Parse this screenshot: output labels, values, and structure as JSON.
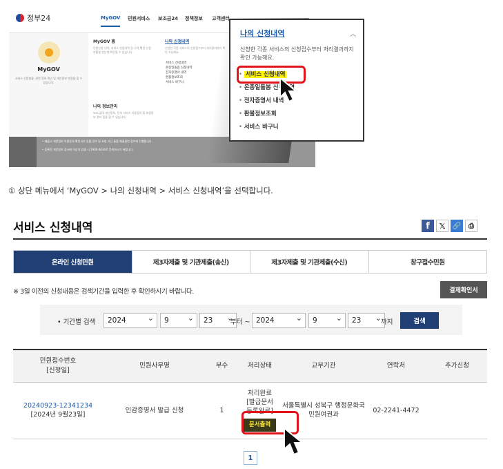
{
  "tutorial": {
    "logo": "정부24",
    "gnb": [
      "MyGOV",
      "민원서비스",
      "보조금24",
      "정책정보",
      "고객센터"
    ],
    "left_panel": {
      "title": "MyGOV",
      "desc": "서비스 신청현황, 관련 정보 확인 및 개인정보 변경을 할 수 있습니다."
    },
    "col1_title": "MyGOV 홈",
    "col1_desc": "민원신청 내역, 서비스 신청내역 등 나의 행정 신청 현황을 한눈에 확인할 수 있습니다.",
    "col1b_title": "나의 정보관리",
    "col1b_desc": "보조금24 개인정보, 전자 서비스 자동동의 및 회원정보 관리 등을 할 수 있습니다.",
    "col2_title": "나의 신청내역",
    "col2_desc": "신청한 각종 서비스의 신청접수부터 처리결과까지 확인 가능해요.",
    "col2_items": [
      "서비스 신청내역",
      "온종일돌봄 신청내역",
      "전자증명서 내역",
      "환불정보조회",
      "서비스 바구니"
    ],
    "band_lines": [
      "• 제출시 개인정보 이용동의 확인서가 있을 경우 및 요청 기간 통합 해결관련 접수에 진행됩니다.",
      "• 등록된 개인정보 검사에 이상이 있을 시 1900-4634로 문의하시기 바랍니다."
    ],
    "zoom": {
      "title": "나의 신청내역",
      "desc": "신청한 각종 서비스의 신청접수부터 처리결과까지 확인 가능해요.",
      "items": [
        "서비스 신청내역",
        "온종일돌봄 신청내역",
        "전자증명서 내역",
        "환불정보조회",
        "서비스 바구니"
      ]
    }
  },
  "caption": "① 상단 메뉴에서 ‘MyGOV > 나의 신청내역 > 서비스 신청내역’을 선택합니다.",
  "page": {
    "title": "서비스 신청내역",
    "share_icons": [
      "facebook-icon",
      "x-icon",
      "link-icon",
      "print-icon"
    ]
  },
  "tabs": [
    "온라인 신청민원",
    "제3자제출 및 기관제출(송신)",
    "제3자제출 및 기관제출(수신)",
    "창구접수민원"
  ],
  "notice": "※ 3일 이전의 신청내용은 검색기간을 입력한 후 확인하시기 바랍니다.",
  "pay_button": "결제확인서",
  "search": {
    "label": "• 기간별 검색",
    "from_year": "2024",
    "from_month": "9",
    "from_day": "23",
    "from_suffix": "부터 ~",
    "to_year": "2024",
    "to_month": "9",
    "to_day": "23",
    "to_suffix": "까지",
    "button": "검색"
  },
  "table": {
    "headers": [
      "민원접수번호\n[신청일]",
      "민원사무명",
      "부수",
      "처리상태",
      "교부기관",
      "연락처",
      "추가신청"
    ],
    "row": {
      "receipt_no": "20240923-12341234",
      "date": "[2024년 9월23일]",
      "name": "인감증명서 발급 신청",
      "count": "1",
      "status_lines": [
        "처리완료",
        "[발급문서",
        "등록완료]"
      ],
      "print_button": "문서출력",
      "agency": "서울특별시 성북구 행정문화국 민원여권과",
      "phone": "02-2241-4472",
      "extra": ""
    }
  },
  "pager": "1",
  "colors": {
    "primary": "#1f3f75",
    "link": "#1f5aa6",
    "highlight": "#fff200",
    "annotation_red": "#e3131b"
  }
}
